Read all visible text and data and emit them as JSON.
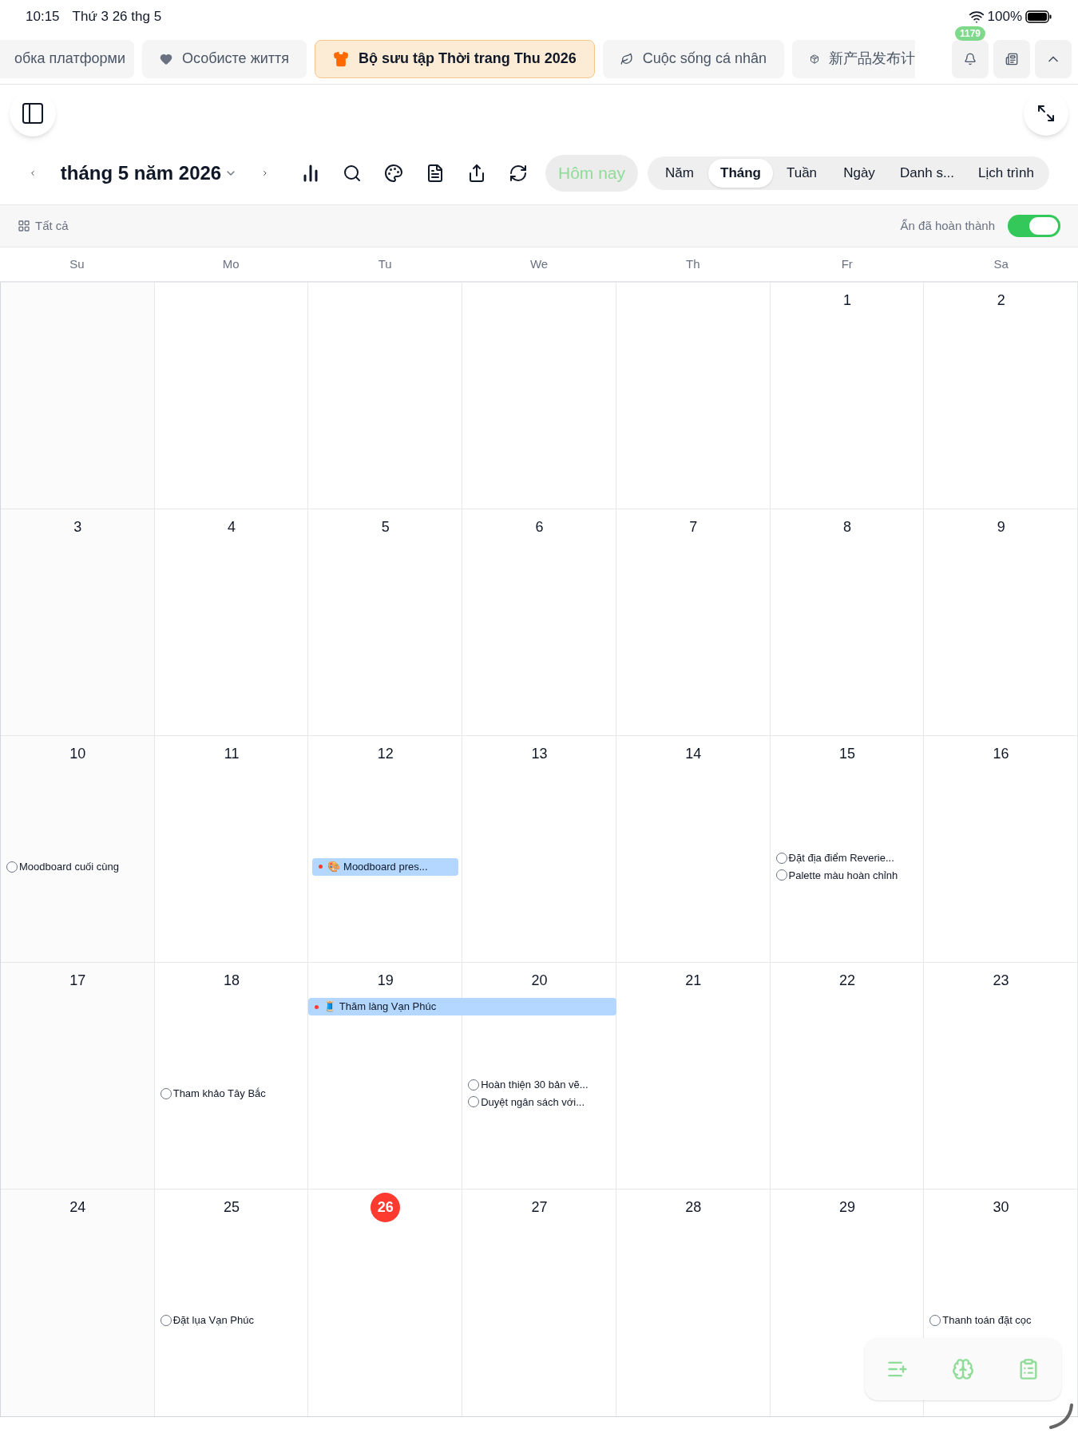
{
  "status_bar": {
    "time": "10:15",
    "date": "Thứ 3 26 thg 5",
    "battery": "100%"
  },
  "tabs": [
    {
      "label": "обка платформи",
      "selected": false
    },
    {
      "label": "Особисте життя",
      "selected": false
    },
    {
      "label": "Bộ sưu tập Thời trang Thu 2026",
      "selected": true
    },
    {
      "label": "Cuộc sống cá nhân",
      "selected": false
    },
    {
      "label": "新产品发布计",
      "selected": false
    }
  ],
  "notification_badge": "1179",
  "toolbar": {
    "title": "tháng 5 năm 2026",
    "today_button": "Hôm nay",
    "views": [
      {
        "label": "Năm",
        "selected": false
      },
      {
        "label": "Tháng",
        "selected": true
      },
      {
        "label": "Tuần",
        "selected": false
      },
      {
        "label": "Ngày",
        "selected": false
      },
      {
        "label": "Danh s...",
        "selected": false
      },
      {
        "label": "Lịch trình",
        "selected": false
      }
    ]
  },
  "filter": {
    "label": "Tất cả",
    "toggle_label": "Ẩn đã hoàn thành",
    "toggle_on": true
  },
  "weekdays": [
    "Su",
    "Mo",
    "Tu",
    "We",
    "Th",
    "Fr",
    "Sa"
  ],
  "weeks": [
    [
      {
        "number": "1",
        "today": false
      },
      {
        "number": "2",
        "today": false
      }
    ],
    [
      {
        "number": "3",
        "today": false
      },
      {
        "number": "4",
        "today": false
      },
      {
        "number": "5",
        "today": false
      },
      {
        "number": "6",
        "today": false
      },
      {
        "number": "7",
        "today": false
      },
      {
        "number": "8",
        "today": false
      },
      {
        "number": "9",
        "today": false
      }
    ],
    [
      {
        "number": "10",
        "today": false,
        "items": [
          {
            "kind": "task",
            "title": "Moodboard cuối cùng",
            "done": false
          }
        ]
      },
      {
        "number": "11",
        "today": false
      },
      {
        "number": "12",
        "today": false,
        "items": [
          {
            "kind": "event",
            "emoji": "🎨",
            "title": "Moodboard pres...",
            "color": "#ff3b30",
            "spans_next_day": false
          }
        ]
      },
      {
        "number": "13",
        "today": false
      },
      {
        "number": "14",
        "today": false
      },
      {
        "number": "15",
        "today": false,
        "items": [
          {
            "kind": "task",
            "title": "Đặt địa điểm Reverie...",
            "done": false
          },
          {
            "kind": "task",
            "title": "Palette màu hoàn chỉnh",
            "done": false
          }
        ]
      },
      {
        "number": "16",
        "today": false
      }
    ],
    [
      {
        "number": "17",
        "today": false
      },
      {
        "number": "18",
        "today": false,
        "items": [
          {
            "kind": "task",
            "title": "Tham khảo Tây Bắc",
            "done": false
          }
        ]
      },
      {
        "number": "19",
        "today": false,
        "items": [
          {
            "kind": "event",
            "emoji": "🧵",
            "title": "Thăm làng Vạn Phúc",
            "color": "#ff3b30",
            "spans_next_day": true
          }
        ]
      },
      {
        "number": "20",
        "today": false,
        "items": [
          {
            "kind": "task",
            "title": "Hoàn thiện 30 bản vẽ...",
            "done": false
          },
          {
            "kind": "task",
            "title": "Duyệt ngân sách với...",
            "done": false
          }
        ]
      },
      {
        "number": "21",
        "today": false
      },
      {
        "number": "22",
        "today": false
      },
      {
        "number": "23",
        "today": false
      }
    ],
    [
      {
        "number": "24",
        "today": false
      },
      {
        "number": "25",
        "today": false,
        "items": [
          {
            "kind": "task",
            "title": "Đặt lụa Vạn Phúc",
            "done": false
          }
        ]
      },
      {
        "number": "26",
        "today": true
      },
      {
        "number": "27",
        "today": false
      },
      {
        "number": "28",
        "today": false
      },
      {
        "number": "29",
        "today": false
      },
      {
        "number": "30",
        "today": false,
        "items": [
          {
            "kind": "task",
            "title": "Thanh toán đặt cọc",
            "done": false
          }
        ]
      }
    ]
  ]
}
